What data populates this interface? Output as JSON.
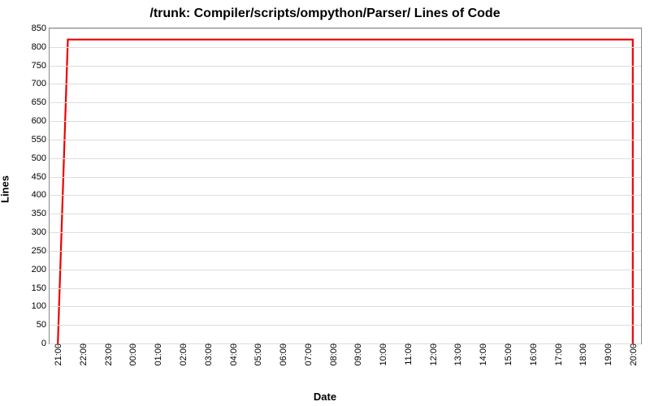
{
  "chart_data": {
    "type": "line",
    "title": "/trunk: Compiler/scripts/ompython/Parser/ Lines of Code",
    "xlabel": "Date",
    "ylabel": "Lines",
    "xlim_index": [
      0,
      23
    ],
    "ylim": [
      0,
      850
    ],
    "y_ticks": [
      0,
      50,
      100,
      150,
      200,
      250,
      300,
      350,
      400,
      450,
      500,
      550,
      600,
      650,
      700,
      750,
      800,
      850
    ],
    "x_categories": [
      "21:00",
      "22:00",
      "23:00",
      "00:00",
      "01:00",
      "02:00",
      "03:00",
      "04:00",
      "05:00",
      "06:00",
      "07:00",
      "08:00",
      "09:00",
      "10:00",
      "11:00",
      "12:00",
      "13:00",
      "14:00",
      "15:00",
      "16:00",
      "17:00",
      "18:00",
      "19:00",
      "20:00"
    ],
    "series": [
      {
        "name": "Lines of Code",
        "color": "#ee0000",
        "x_index": [
          0,
          0.4,
          23,
          23
        ],
        "y": [
          0,
          820,
          820,
          0
        ]
      }
    ]
  }
}
